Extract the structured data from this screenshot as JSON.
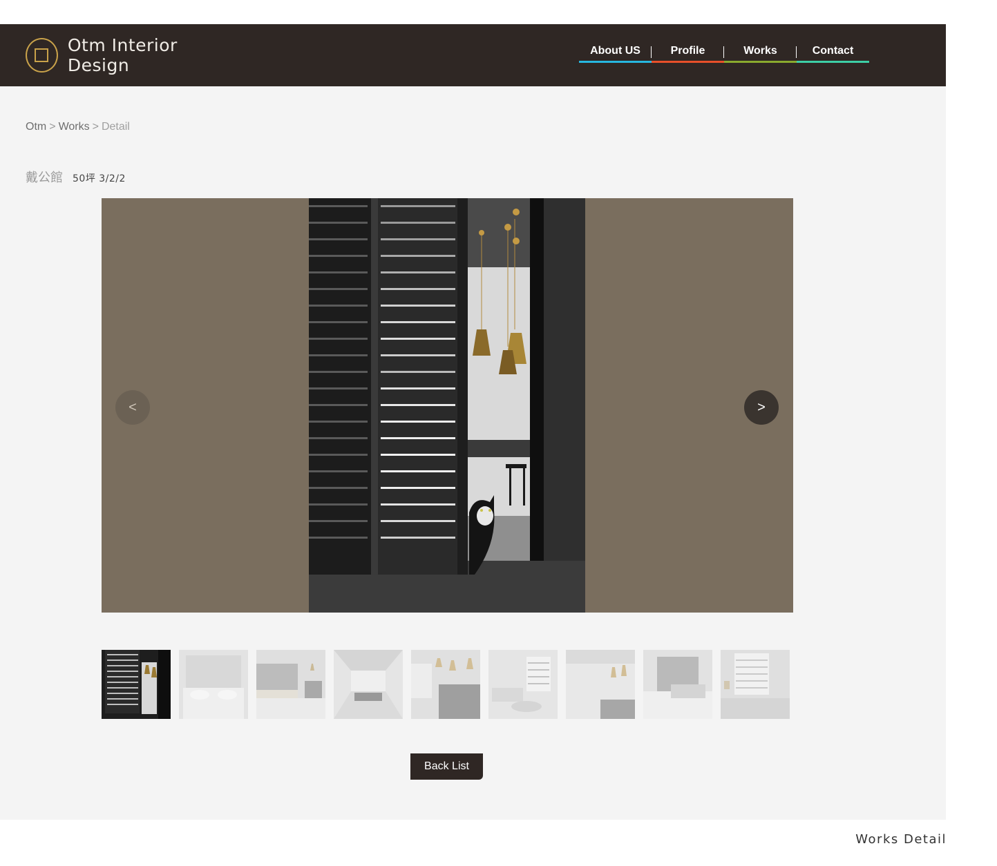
{
  "brand": {
    "name": "Otm Interior Design",
    "gold": "#c9a24a"
  },
  "nav": [
    {
      "label": "About US",
      "color": "#27b7e0"
    },
    {
      "label": "Profile",
      "color": "#e8502a"
    },
    {
      "label": "Works",
      "color": "#8aaa2e"
    },
    {
      "label": "Contact",
      "color": "#3dcfa6"
    }
  ],
  "breadcrumb": {
    "home": "Otm",
    "section": "Works",
    "current": "Detail",
    "separator": ">"
  },
  "project": {
    "name": "戴公館",
    "meta": "50坪 3/2/2"
  },
  "slider": {
    "prev": "<",
    "next": ">",
    "background": "#7a6e5e",
    "selected_index": 0
  },
  "thumbnails": [
    "slide-1",
    "slide-2",
    "slide-3",
    "slide-4",
    "slide-5",
    "slide-6",
    "slide-7",
    "slide-8",
    "slide-9"
  ],
  "back_button": "Back List",
  "caption": "Works Detail"
}
